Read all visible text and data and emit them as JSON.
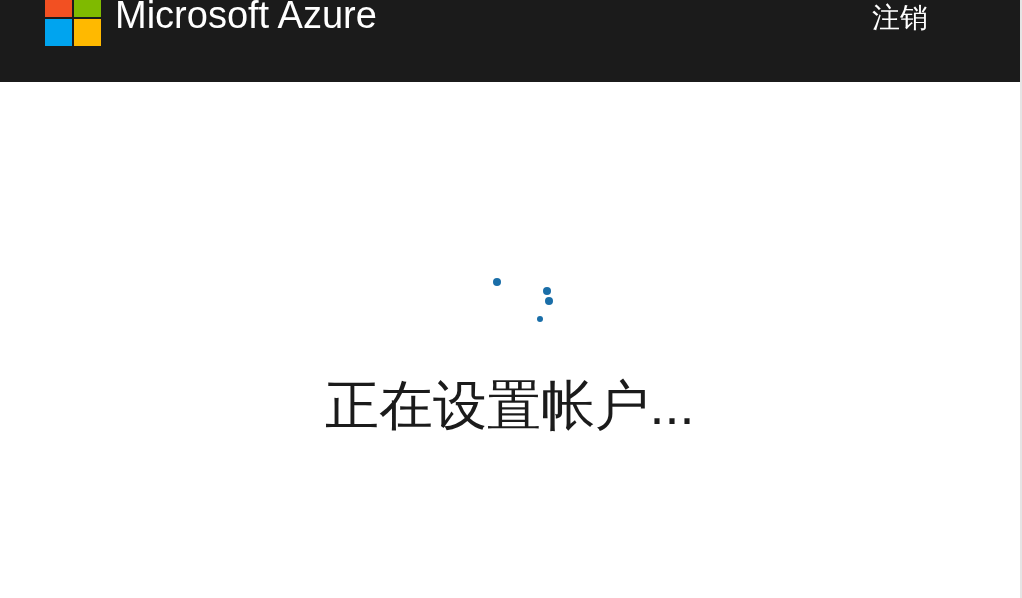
{
  "header": {
    "brand": "Microsoft Azure",
    "sign_out": "注销"
  },
  "status": {
    "message": "正在设置帐户..."
  }
}
